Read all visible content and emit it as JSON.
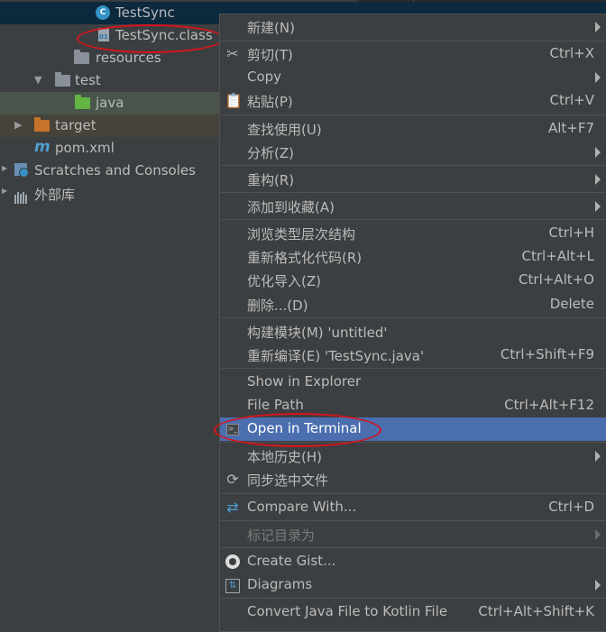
{
  "tree": {
    "items": [
      {
        "label": "TestSync",
        "icon": "class-icon"
      },
      {
        "label": "TestSync.class",
        "icon": "class-file-icon"
      },
      {
        "label": "resources",
        "icon": "resources-folder-icon"
      },
      {
        "label": "test",
        "icon": "folder-icon"
      },
      {
        "label": "java",
        "icon": "test-source-folder-icon"
      },
      {
        "label": "target",
        "icon": "target-folder-icon"
      },
      {
        "label": "pom.xml",
        "icon": "maven-icon"
      },
      {
        "label": "Scratches and Consoles",
        "icon": "scratches-icon"
      },
      {
        "label": "外部库",
        "icon": "library-icon"
      }
    ]
  },
  "menu": {
    "items": [
      {
        "label": "新建(N)",
        "shortcut": "",
        "submenu": true
      },
      {
        "label": "剪切(T)",
        "shortcut": "Ctrl+X",
        "icon": "cut-icon"
      },
      {
        "label": "Copy",
        "shortcut": "",
        "submenu": true
      },
      {
        "label": "粘贴(P)",
        "shortcut": "Ctrl+V",
        "icon": "paste-icon"
      },
      {
        "label": "查找使用(U)",
        "shortcut": "Alt+F7"
      },
      {
        "label": "分析(Z)",
        "shortcut": "",
        "submenu": true
      },
      {
        "label": "重构(R)",
        "shortcut": "",
        "submenu": true
      },
      {
        "label": "添加到收藏(A)",
        "shortcut": "",
        "submenu": true
      },
      {
        "label": "浏览类型层次结构",
        "shortcut": "Ctrl+H"
      },
      {
        "label": "重新格式化代码(R)",
        "shortcut": "Ctrl+Alt+L"
      },
      {
        "label": "优化导入(Z)",
        "shortcut": "Ctrl+Alt+O"
      },
      {
        "label": "删除...(D)",
        "shortcut": "Delete"
      },
      {
        "label": "构建模块(M) 'untitled'",
        "shortcut": ""
      },
      {
        "label": "重新编译(E) 'TestSync.java'",
        "shortcut": "Ctrl+Shift+F9"
      },
      {
        "label": "Show in Explorer",
        "shortcut": ""
      },
      {
        "label": "File Path",
        "shortcut": "Ctrl+Alt+F12"
      },
      {
        "label": "Open in Terminal",
        "shortcut": "",
        "icon": "terminal-icon"
      },
      {
        "label": "本地历史(H)",
        "shortcut": "",
        "submenu": true
      },
      {
        "label": "同步选中文件",
        "shortcut": "",
        "icon": "sync-icon"
      },
      {
        "label": "Compare With...",
        "shortcut": "Ctrl+D",
        "icon": "compare-icon"
      },
      {
        "label": "标记目录为",
        "shortcut": "",
        "submenu": true
      },
      {
        "label": "Create Gist...",
        "shortcut": "",
        "icon": "github-icon"
      },
      {
        "label": "Diagrams",
        "shortcut": "",
        "submenu": true,
        "icon": "diagram-icon"
      },
      {
        "label": "Convert Java File to Kotlin File",
        "shortcut": "Ctrl+Alt+Shift+K"
      }
    ]
  },
  "colors": {
    "background": "#3c3f41",
    "highlight": "#4b6eaf",
    "annotation_red": "#d9141b"
  }
}
